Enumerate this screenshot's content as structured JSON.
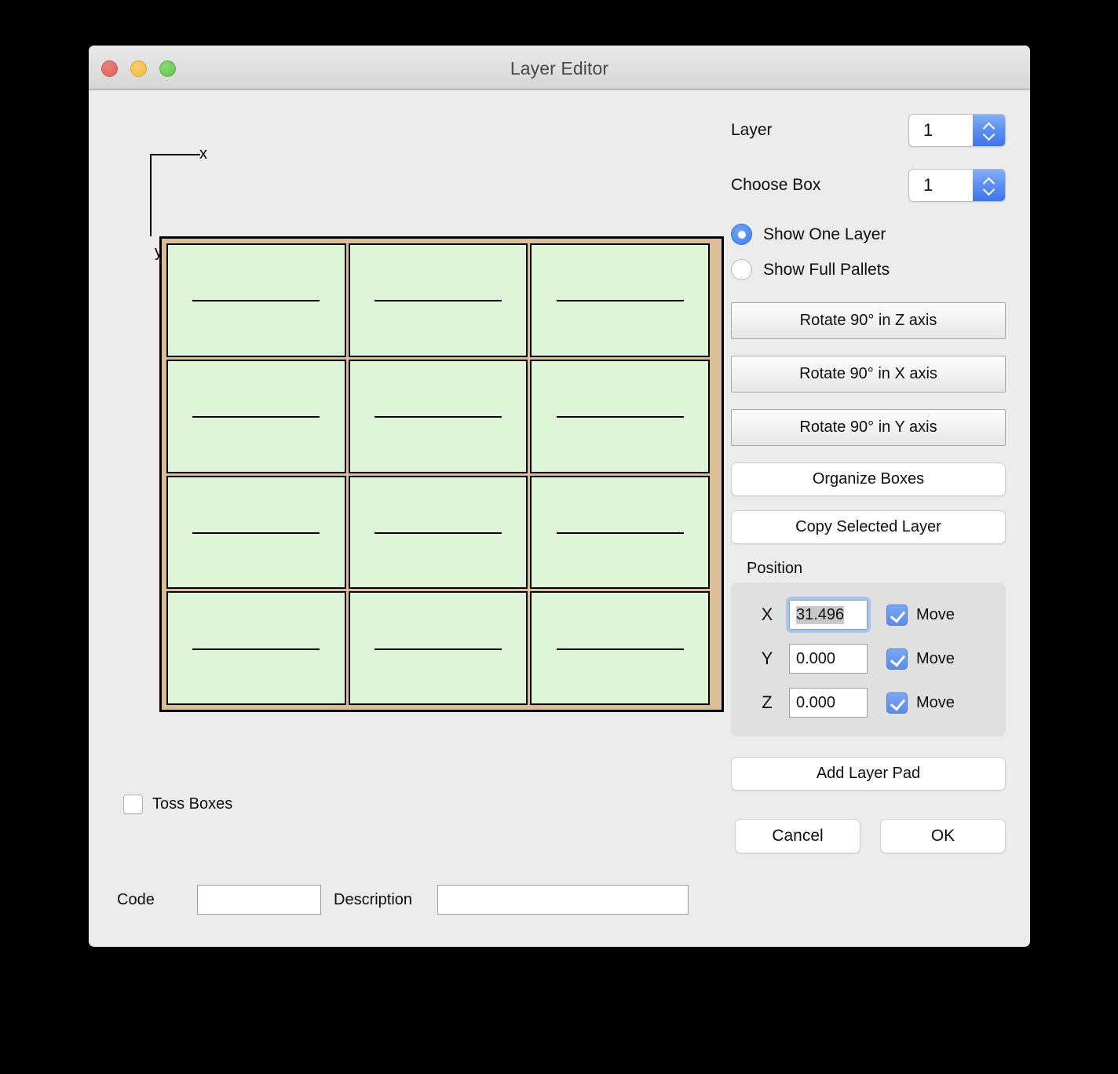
{
  "window": {
    "title": "Layer Editor",
    "traffic_lights": [
      {
        "name": "close",
        "color": "#dc6257"
      },
      {
        "name": "minimize",
        "color": "#eeb93f"
      },
      {
        "name": "zoom",
        "color": "#63c44e"
      }
    ]
  },
  "pallet_view": {
    "axis_x_label": "x",
    "axis_y_label": "y",
    "pallet_color": "#ddbd95",
    "box_color": "#ddf4d7",
    "rows": 4,
    "columns": 3,
    "box_count": 12
  },
  "bottom_left": {
    "toss_boxes_label": "Toss Boxes",
    "toss_boxes_checked": false,
    "code_label": "Code",
    "code_value": "",
    "code_placeholder": "",
    "description_label": "Description",
    "description_value": "",
    "description_placeholder": ""
  },
  "right_panel": {
    "layer": {
      "label": "Layer",
      "value": "1"
    },
    "choose_box": {
      "label": "Choose Box",
      "value": "1"
    },
    "radios": [
      {
        "label": "Show One Layer",
        "selected": true
      },
      {
        "label": "Show Full Pallets",
        "selected": false
      }
    ],
    "buttons": {
      "rotate_z": "Rotate 90° in Z axis",
      "rotate_x": "Rotate 90° in X axis",
      "rotate_y": "Rotate 90° in Y axis",
      "organize_boxes": "Organize Boxes",
      "copy_selected_layer": "Copy Selected Layer",
      "add_layer_pad": "Add Layer Pad",
      "cancel": "Cancel",
      "ok": "OK"
    },
    "position": {
      "legend": "Position",
      "move_label": "Move",
      "axes": [
        {
          "axis": "X",
          "value": "31.496",
          "move_checked": true,
          "focused": true
        },
        {
          "axis": "Y",
          "value": "0.000",
          "move_checked": true,
          "focused": false
        },
        {
          "axis": "Z",
          "value": "0.000",
          "move_checked": true,
          "focused": false
        }
      ]
    }
  },
  "colors": {
    "accent_blue": "#5a8be9",
    "window_bg": "#ececec",
    "group_bg": "#e0e0e0"
  }
}
